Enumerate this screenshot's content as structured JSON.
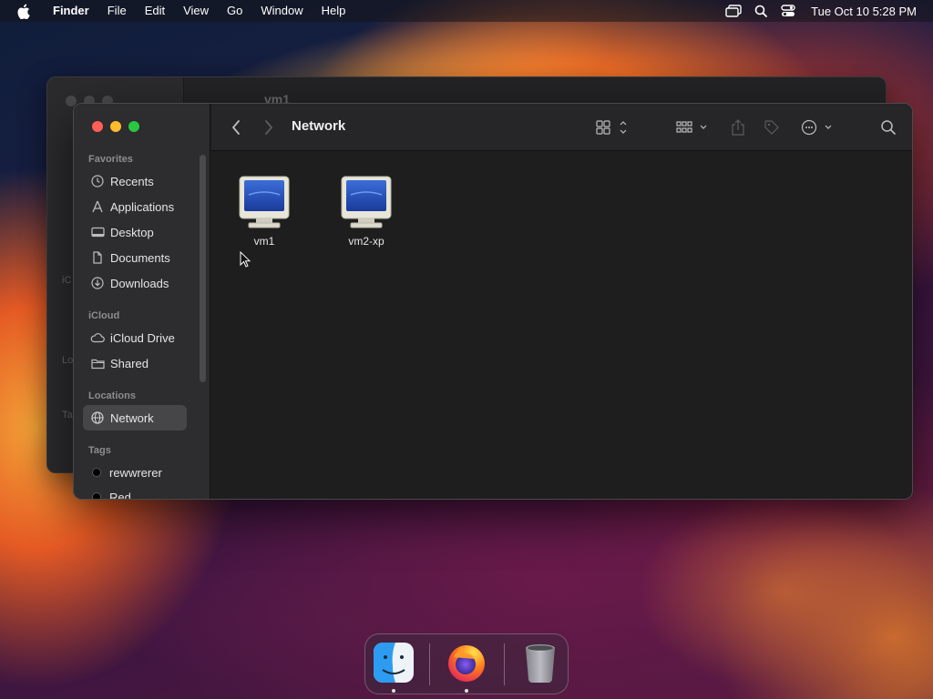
{
  "menubar": {
    "app_name": "Finder",
    "menus": [
      "File",
      "Edit",
      "View",
      "Go",
      "Window",
      "Help"
    ],
    "clock": "Tue Oct 10  5:28 PM",
    "tray_icons": [
      "screen-mirroring-icon",
      "spotlight-search-icon",
      "control-center-icon"
    ]
  },
  "background_window": {
    "title": "vm1",
    "partial_labels": [
      "iC",
      "Lo",
      "Ta"
    ]
  },
  "window": {
    "title": "Network",
    "sidebar": {
      "favorites_label": "Favorites",
      "favorites": [
        {
          "label": "Recents",
          "icon": "clock-icon"
        },
        {
          "label": "Applications",
          "icon": "applications-icon"
        },
        {
          "label": "Desktop",
          "icon": "desktop-icon"
        },
        {
          "label": "Documents",
          "icon": "document-icon"
        },
        {
          "label": "Downloads",
          "icon": "download-icon"
        }
      ],
      "icloud_label": "iCloud",
      "icloud": [
        {
          "label": "iCloud Drive",
          "icon": "cloud-icon"
        },
        {
          "label": "Shared",
          "icon": "shared-folder-icon"
        }
      ],
      "locations_label": "Locations",
      "locations": [
        {
          "label": "Network",
          "icon": "globe-icon",
          "selected": true
        }
      ],
      "tags_label": "Tags",
      "tags": [
        {
          "label": "rewwrerer",
          "color": "#000000"
        },
        {
          "label": "Red",
          "color": "#000000"
        }
      ]
    },
    "items": [
      {
        "label": "vm1",
        "icon": "computer-monitor-icon"
      },
      {
        "label": "vm2-xp",
        "icon": "computer-monitor-icon"
      }
    ]
  },
  "dock": {
    "apps": [
      {
        "name": "Finder",
        "icon": "finder-icon",
        "running": true
      },
      {
        "name": "Firefox",
        "icon": "firefox-icon",
        "running": true
      },
      {
        "name": "Trash",
        "icon": "trash-icon",
        "running": false
      }
    ]
  },
  "colors": {
    "close": "#ff5f57",
    "minimize": "#febc2e",
    "zoom": "#28c840",
    "selection": "#464648"
  }
}
